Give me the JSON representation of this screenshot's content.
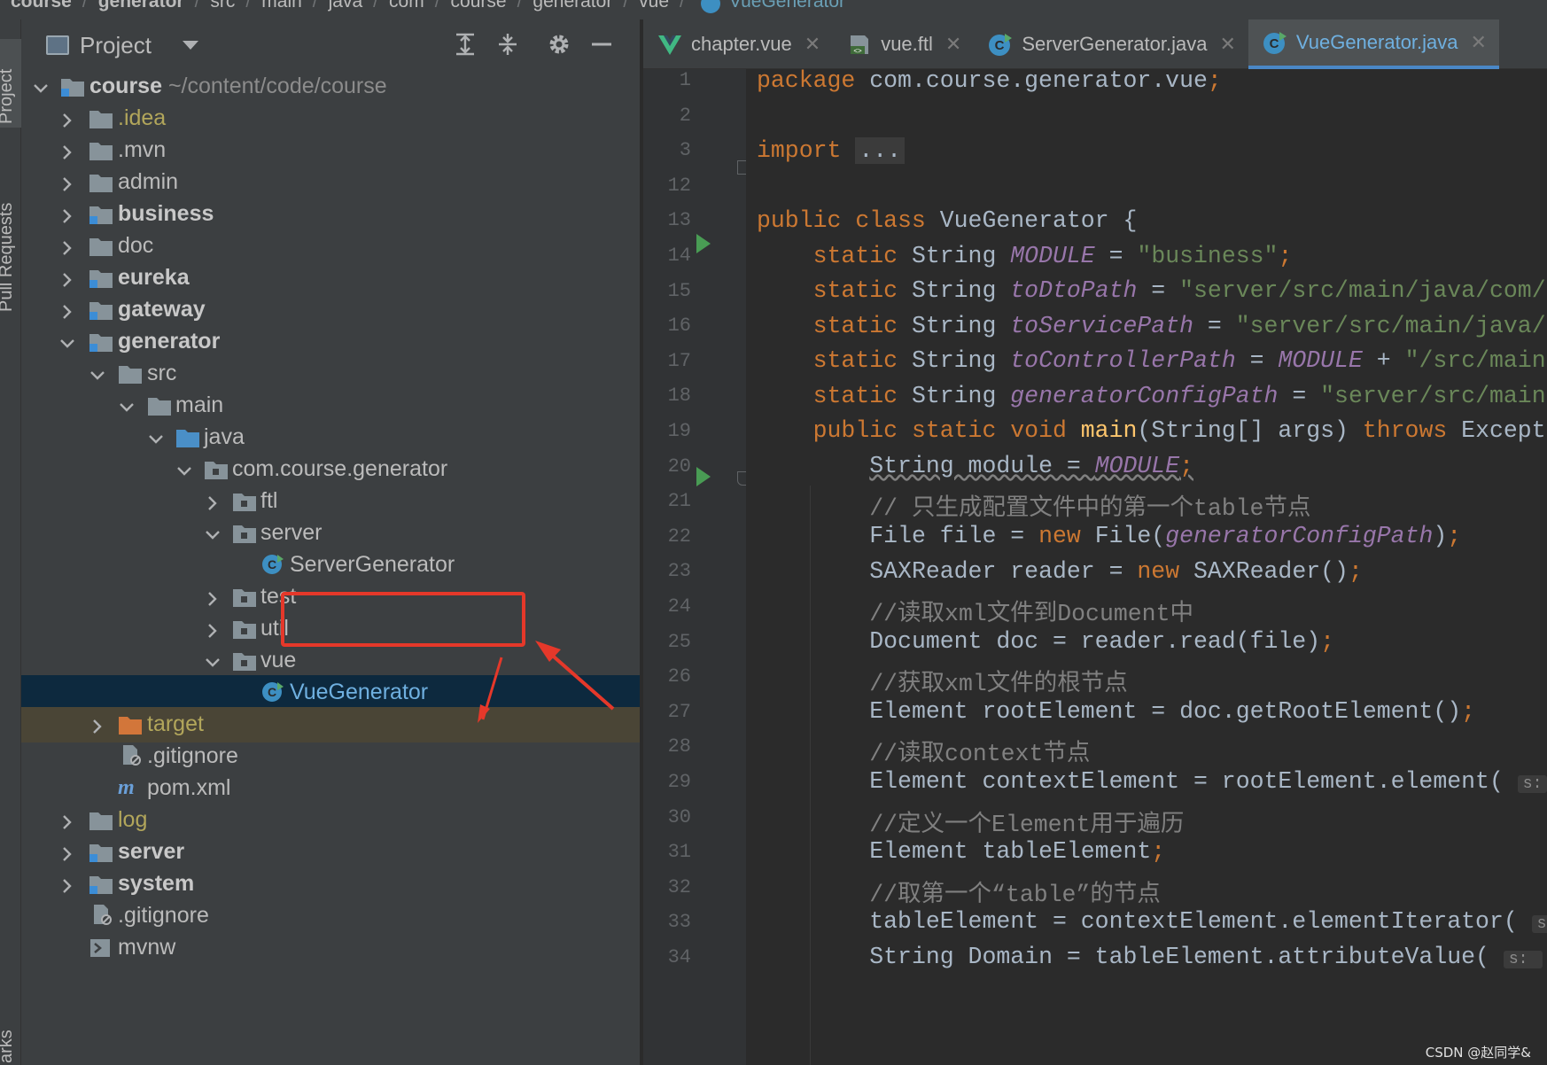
{
  "breadcrumb": {
    "items": [
      "course",
      "generator",
      "src",
      "main",
      "java",
      "com",
      "course",
      "generator",
      "vue",
      "VueGenerator"
    ]
  },
  "stripe": {
    "project_label": "Project",
    "pr_label": "Pull Requests",
    "bookmarks_label": "arks"
  },
  "panel": {
    "title": "Project"
  },
  "tree": {
    "root_name": "course",
    "root_path": "~/content/code/course",
    "idea": ".idea",
    "mvn": ".mvn",
    "admin": "admin",
    "business": "business",
    "doc": "doc",
    "eureka": "eureka",
    "gateway": "gateway",
    "generator": "generator",
    "src": "src",
    "main": "main",
    "java": "java",
    "pkg": "com.course.generator",
    "ftl": "ftl",
    "server_pkg": "server",
    "server_generator": "ServerGenerator",
    "test": "test",
    "util": "util",
    "vue": "vue",
    "vue_generator": "VueGenerator",
    "target": "target",
    "gitignore_inner": ".gitignore",
    "pom": "pom.xml",
    "log": "log",
    "server": "server",
    "system": "system",
    "gitignore_root": ".gitignore",
    "mvnw": "mvnw"
  },
  "tabs": [
    {
      "label": "chapter.vue",
      "icon": "vue-icon"
    },
    {
      "label": "vue.ftl",
      "icon": "ftl-icon"
    },
    {
      "label": "ServerGenerator.java",
      "icon": "class-icon"
    },
    {
      "label": "VueGenerator.java",
      "icon": "class-icon",
      "active": true
    }
  ],
  "line_numbers": [
    "1",
    "2",
    "3",
    "12",
    "13",
    "14",
    "15",
    "16",
    "17",
    "18",
    "19",
    "20",
    "21",
    "22",
    "23",
    "24",
    "25",
    "26",
    "27",
    "28",
    "29",
    "30",
    "31",
    "32",
    "33",
    "34"
  ],
  "code": {
    "l1_kw": "package",
    "l1_rest": " com.course.generator.vue",
    "l1_semi": ";",
    "l3_kw": "import",
    "l3_dots": "...",
    "l13_kw": "public class",
    "l13_rest": " VueGenerator {",
    "static": "static",
    "string_t": " String ",
    "eq": " = ",
    "l14_name": "MODULE",
    "l14_str": "\"business\"",
    "l15_name": "toDtoPath",
    "l15_str": "\"server/src/main/java/com/",
    "l16_name": "toServicePath",
    "l16_str": "\"server/src/main/java/",
    "l17_name": "toControllerPath",
    "l17_mod": "MODULE",
    "l17_plus": " + ",
    "l17_str": "\"/src/main",
    "l18_name": "generatorConfigPath",
    "l18_str": "\"server/src/main",
    "l19_kw1": "public static void",
    "l19_fn": " main",
    "l19_args": "(String[] args) ",
    "l19_throws": "throws",
    "l19_rest": " Except",
    "l20_a": "String module = ",
    "l20_b": "MODULE",
    "l21": "// 只生成配置文件中的第一个table节点",
    "l22_a": "File file = ",
    "l22_new": "new",
    "l22_b": " File(",
    "l22_c": "generatorConfigPath",
    "l22_d": ")",
    "l23_a": "SAXReader reader = ",
    "l23_new": "new",
    "l23_b": " SAXReader()",
    "l24": "//读取xml文件到Document中",
    "l25": "Document doc = reader.read(file)",
    "l26": "//获取xml文件的根节点",
    "l27": "Element rootElement = doc.getRootElement()",
    "l28": "//读取context节点",
    "l29": "Element contextElement = rootElement.element(",
    "l29_hint": "s:",
    "l30": "//定义一个Element用于遍历",
    "l31": "Element tableElement",
    "l32": "//取第一个“table”的节点",
    "l33": "tableElement = contextElement.elementIterator(",
    "l33_hint": "s",
    "l34": "String Domain = tableElement.attributeValue(",
    "l34_hint": "s: ",
    "semi": ";"
  },
  "watermark": "CSDN @赵同学&",
  "colors": {
    "keyword": "#cc7832",
    "field": "#9876aa",
    "string": "#6a8759",
    "comment": "#808080",
    "method": "#ffc66d",
    "annotation_red": "#e5382a",
    "selection": "#0d293e"
  }
}
